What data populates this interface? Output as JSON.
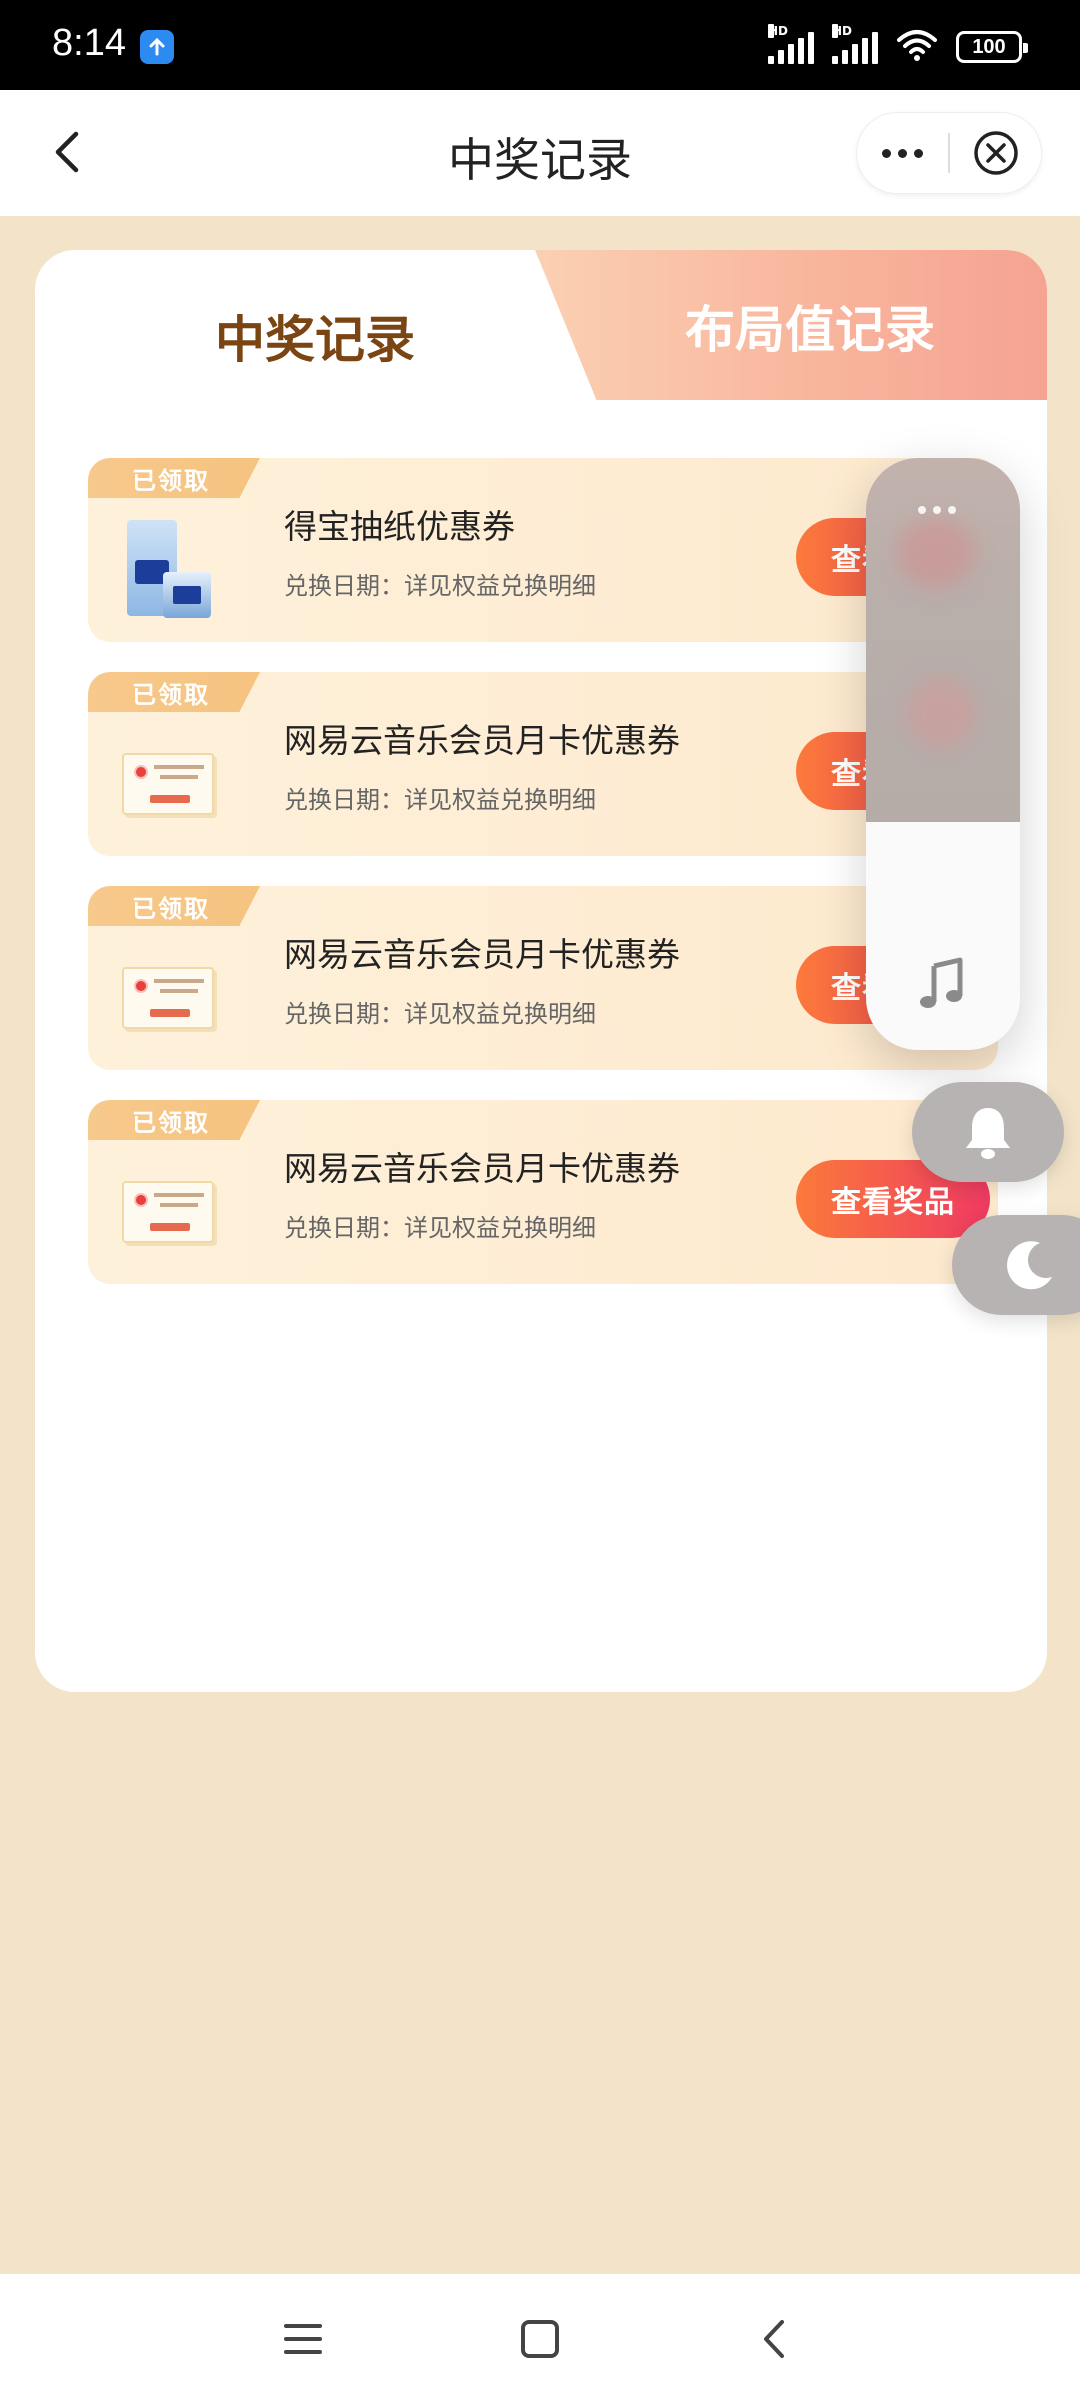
{
  "status_bar": {
    "time": "8:14",
    "battery": "100",
    "hd1": "HD",
    "hd2": "HD",
    "icons": [
      "upload-icon",
      "signal-icon",
      "signal-icon",
      "wifi-icon",
      "battery-icon"
    ]
  },
  "navbar": {
    "title": "中奖记录",
    "icons": [
      "back-icon",
      "more-icon",
      "close-icon"
    ]
  },
  "tabs": [
    {
      "label": "中奖记录",
      "active": true
    },
    {
      "label": "布局值记录",
      "active": false
    }
  ],
  "records": [
    {
      "badge": "已领取",
      "title": "得宝抽纸优惠券",
      "subtitle": "兑换日期：详见权益兑换明细",
      "button": "查看奖品",
      "thumb": "tissue-image"
    },
    {
      "badge": "已领取",
      "title": "网易云音乐会员月卡优惠券",
      "subtitle": "兑换日期：详见权益兑换明细",
      "button": "查看奖品",
      "thumb": "coupon-image"
    },
    {
      "badge": "已领取",
      "title": "网易云音乐会员月卡优惠券",
      "subtitle": "兑换日期：详见权益兑换明细",
      "button": "查看奖品",
      "thumb": "coupon-image"
    },
    {
      "badge": "已领取",
      "title": "网易云音乐会员月卡优惠券",
      "subtitle": "兑换日期：详见权益兑换明细",
      "button": "查看奖品",
      "thumb": "coupon-image"
    }
  ],
  "floating": {
    "icons": [
      "more-icon",
      "music-note-icon",
      "bell-icon",
      "moon-icon"
    ]
  },
  "bottom_nav": {
    "icons": [
      "menu-icon",
      "home-icon",
      "back-icon"
    ]
  },
  "colors": {
    "page_bg": "#f3e4c9",
    "accent_button_start": "#fb7a3a",
    "accent_button_end": "#ef3a62",
    "active_tab_text": "#7a4512",
    "badge": "#f7c98c"
  }
}
